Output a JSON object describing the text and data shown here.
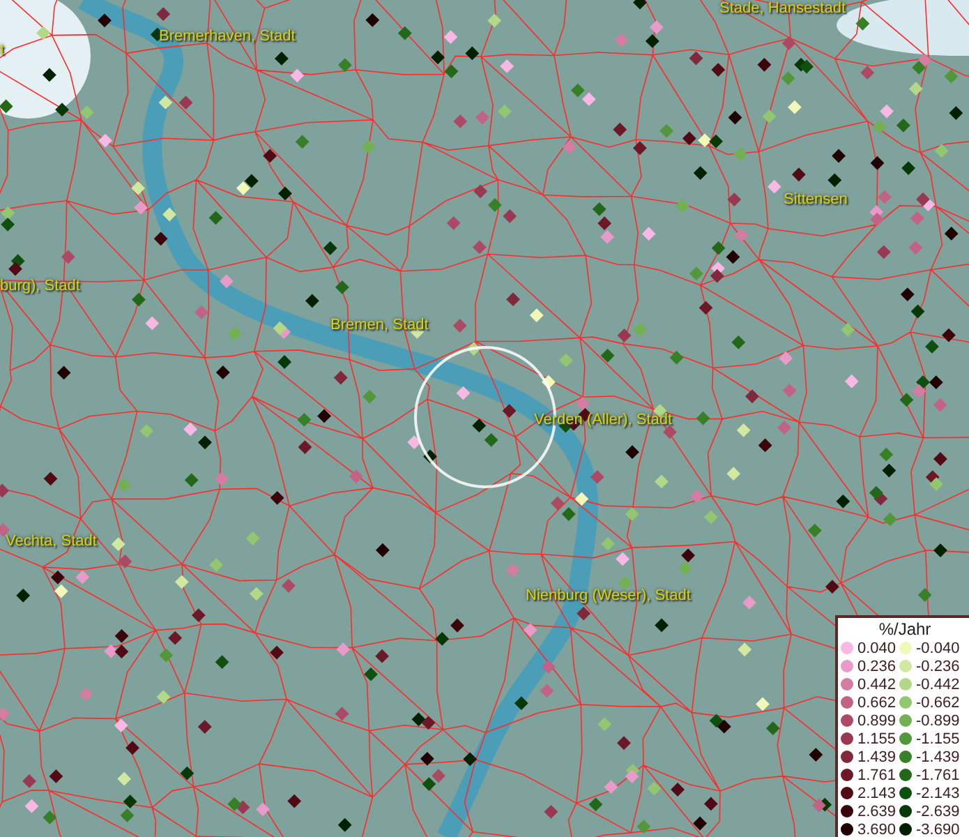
{
  "map": {
    "places": [
      {
        "name": "t"
      },
      {
        "name": "Bremerhaven, Stadt"
      },
      {
        "name": "Stade, Hansestadt"
      },
      {
        "name": "Sittensen"
      },
      {
        "name": "burg), Stadt"
      },
      {
        "name": "Bremen, Stadt"
      },
      {
        "name": "Verden (Aller), Stadt"
      },
      {
        "name": "Vechta, Stadt"
      },
      {
        "name": "Nienburg (Weser), Stadt"
      }
    ]
  },
  "legend": {
    "title": "%/Jahr",
    "positive": [
      {
        "label": "0.040",
        "color": "#f8b8e4"
      },
      {
        "label": "0.236",
        "color": "#e89ac8"
      },
      {
        "label": "0.442",
        "color": "#d47ca2"
      },
      {
        "label": "0.662",
        "color": "#c26284"
      },
      {
        "label": "0.899",
        "color": "#ac4a66"
      },
      {
        "label": "1.155",
        "color": "#983852"
      },
      {
        "label": "1.439",
        "color": "#82283c"
      },
      {
        "label": "1.761",
        "color": "#6c1828"
      },
      {
        "label": "2.143",
        "color": "#520a14"
      },
      {
        "label": "2.639",
        "color": "#3a040a"
      },
      {
        "label": "3.690",
        "color": "#200000"
      }
    ],
    "negative": [
      {
        "label": "-0.040",
        "color": "#f2f8b8"
      },
      {
        "label": "-0.236",
        "color": "#d2e8a0"
      },
      {
        "label": "-0.442",
        "color": "#b2d888"
      },
      {
        "label": "-0.662",
        "color": "#92c670"
      },
      {
        "label": "-0.899",
        "color": "#72b052"
      },
      {
        "label": "-1.155",
        "color": "#52983a"
      },
      {
        "label": "-1.439",
        "color": "#388028"
      },
      {
        "label": "-1.761",
        "color": "#226818"
      },
      {
        "label": "-2.143",
        "color": "#10500e"
      },
      {
        "label": "-2.639",
        "color": "#083808"
      },
      {
        "label": "-3.690",
        "color": "#002000"
      }
    ]
  }
}
